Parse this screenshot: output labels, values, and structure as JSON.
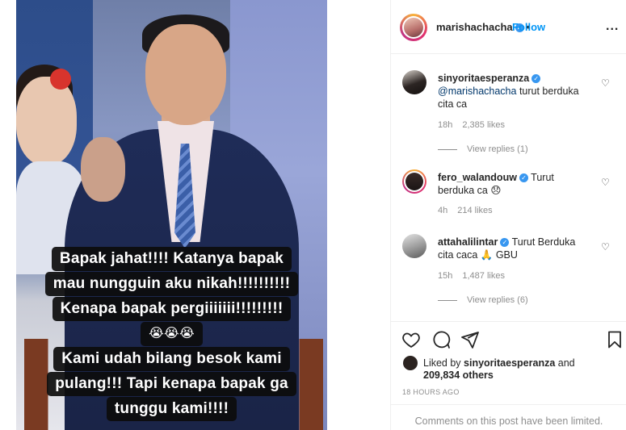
{
  "post": {
    "caption_lines": [
      "Bapak jahat!!!! Katanya bapak",
      "mau nungguin aku nikah!!!!!!!!!!",
      "Kenapa bapak pergiiiiiii!!!!!!!!!",
      "😭😭😭",
      "Kami udah bilang besok kami",
      "pulang!!! Tapi kenapa bapak ga",
      "tunggu kami!!!!"
    ]
  },
  "header": {
    "username": "marishachacha",
    "follow_label": "Follow",
    "more_label": "..."
  },
  "comments": [
    {
      "username": "sinyoritaesperanza",
      "mention": "@marishachacha",
      "text": " turut berduka cita ca",
      "time": "18h",
      "likes": "2,385 likes",
      "replies": "View replies (1)"
    },
    {
      "username": "fero_walandouw",
      "text": " Turut berduka ca 😞",
      "time": "4h",
      "likes": "214 likes"
    },
    {
      "username": "attahalilintar",
      "text": " Turut Berduka cita caca 🙏 GBU",
      "time": "15h",
      "likes": "1,487 likes",
      "replies": "View replies (6)"
    }
  ],
  "footer": {
    "liked_by_prefix": "Liked by ",
    "liked_by_user": "sinyoritaesperanza",
    "liked_by_and": " and",
    "liked_by_others": "209,834 others",
    "timestamp": "18 HOURS AGO",
    "comments_limited": "Comments on this post have been limited."
  },
  "colors": {
    "follow": "#0095f6",
    "verified": "#3897f0",
    "muted": "#8e8e8e",
    "text": "#262626"
  },
  "icons": [
    "heart-icon",
    "comment-icon",
    "share-icon",
    "bookmark-icon",
    "verified-icon",
    "more-icon"
  ]
}
